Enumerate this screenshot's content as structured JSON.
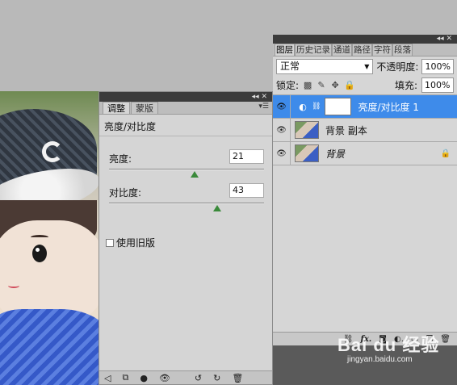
{
  "adjustments": {
    "tabs": [
      "调整",
      "蒙版"
    ],
    "heading": "亮度/对比度",
    "brightness": {
      "label": "亮度:",
      "value": "21",
      "fraction": 0.55
    },
    "contrast": {
      "label": "对比度:",
      "value": "43",
      "fraction": 0.7
    },
    "legacy_label": "使用旧版"
  },
  "layers": {
    "tabs": [
      "图层",
      "历史记录",
      "通道",
      "路径",
      "字符",
      "段落"
    ],
    "blend_mode": "正常",
    "opacity_label": "不透明度:",
    "opacity_value": "100%",
    "lock_label": "锁定:",
    "fill_label": "填充:",
    "fill_value": "100%",
    "items": [
      {
        "name": "亮度/对比度 1",
        "selected": true
      },
      {
        "name": "背景 副本",
        "selected": false
      },
      {
        "name": "背景",
        "selected": false,
        "locked": true
      }
    ]
  },
  "watermark": {
    "main": "Bai du 经验",
    "sub": "jingyan.baidu.com"
  }
}
